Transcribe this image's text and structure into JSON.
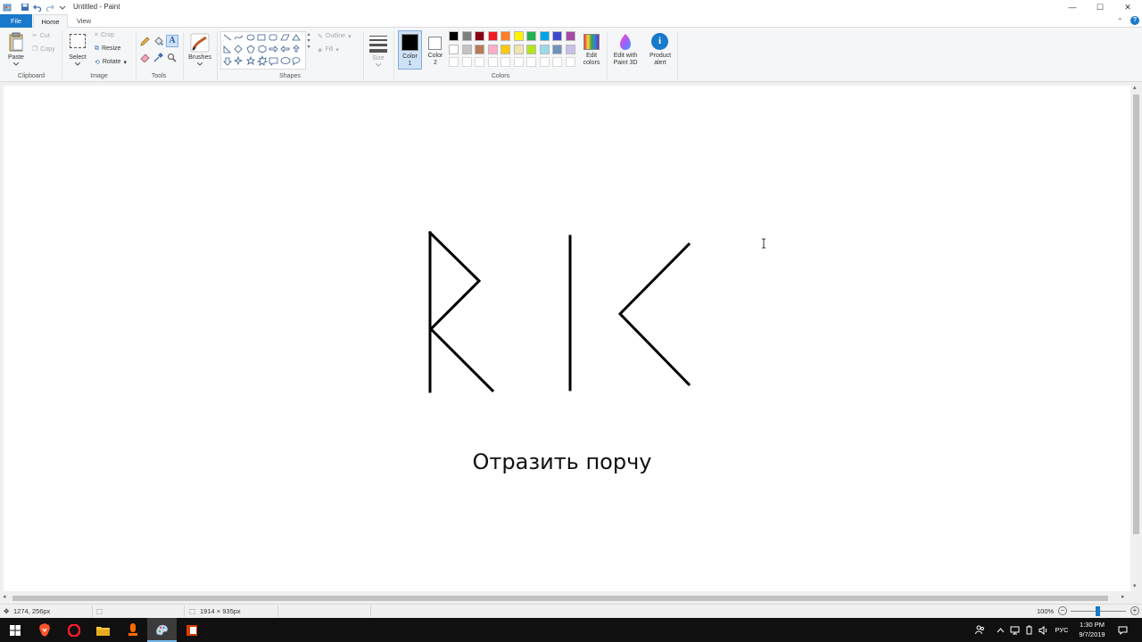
{
  "window": {
    "title": "Untitled - Paint",
    "minimize_glyph": "—",
    "maximize_glyph": "☐",
    "close_glyph": "✕",
    "help_glyph": "?",
    "collapse_glyph": "⌃"
  },
  "menu": {
    "file": "File",
    "home": "Home",
    "view": "View"
  },
  "ribbon": {
    "clipboard": {
      "paste": "Paste",
      "cut": "Cut",
      "copy": "Copy",
      "group": "Clipboard"
    },
    "image": {
      "select": "Select",
      "crop": "Crop",
      "resize": "Resize",
      "rotate": "Rotate",
      "group": "Image"
    },
    "tools": {
      "group": "Tools",
      "text_glyph": "A"
    },
    "brushes": {
      "label": "Brushes"
    },
    "shapes": {
      "group": "Shapes",
      "outline": "Outline",
      "fill": "Fill"
    },
    "size": {
      "label": "Size"
    },
    "color1": {
      "line1": "Color",
      "line2": "1",
      "value": "#000000"
    },
    "color2": {
      "line1": "Color",
      "line2": "2",
      "value": "#ffffff"
    },
    "colors_group": "Colors",
    "edit_colors": {
      "line1": "Edit",
      "line2": "colors"
    },
    "paint3d": {
      "line1": "Edit with",
      "line2": "Paint 3D"
    },
    "product_alert": {
      "line1": "Product",
      "line2": "alert"
    },
    "palette_row1": [
      "#000000",
      "#7f7f7f",
      "#880015",
      "#ed1c24",
      "#ff7f27",
      "#fff200",
      "#22b14c",
      "#00a2e8",
      "#3f48cc",
      "#a349a4"
    ],
    "palette_row2": [
      "#ffffff",
      "#c3c3c3",
      "#b97a57",
      "#ffaec9",
      "#ffc90e",
      "#efe4b0",
      "#b5e61d",
      "#99d9ea",
      "#7092be",
      "#c8bfe7"
    ],
    "palette_row3": [
      "#ffffff",
      "#ffffff",
      "#ffffff",
      "#ffffff",
      "#ffffff",
      "#ffffff",
      "#ffffff",
      "#ffffff",
      "#ffffff",
      "#ffffff"
    ]
  },
  "canvas": {
    "caption": "Отразить порчу"
  },
  "status": {
    "cursor_pos": "1274, 256px",
    "canvas_size": "1914 × 935px",
    "zoom": "100%"
  },
  "taskbar": {
    "lang": "РУС",
    "time": "1:30 PM",
    "date": "9/7/2019"
  },
  "colors": {
    "accent": "#1979ca",
    "ribbon_bg": "#f5f6f7",
    "taskbar_bg": "#101010"
  }
}
